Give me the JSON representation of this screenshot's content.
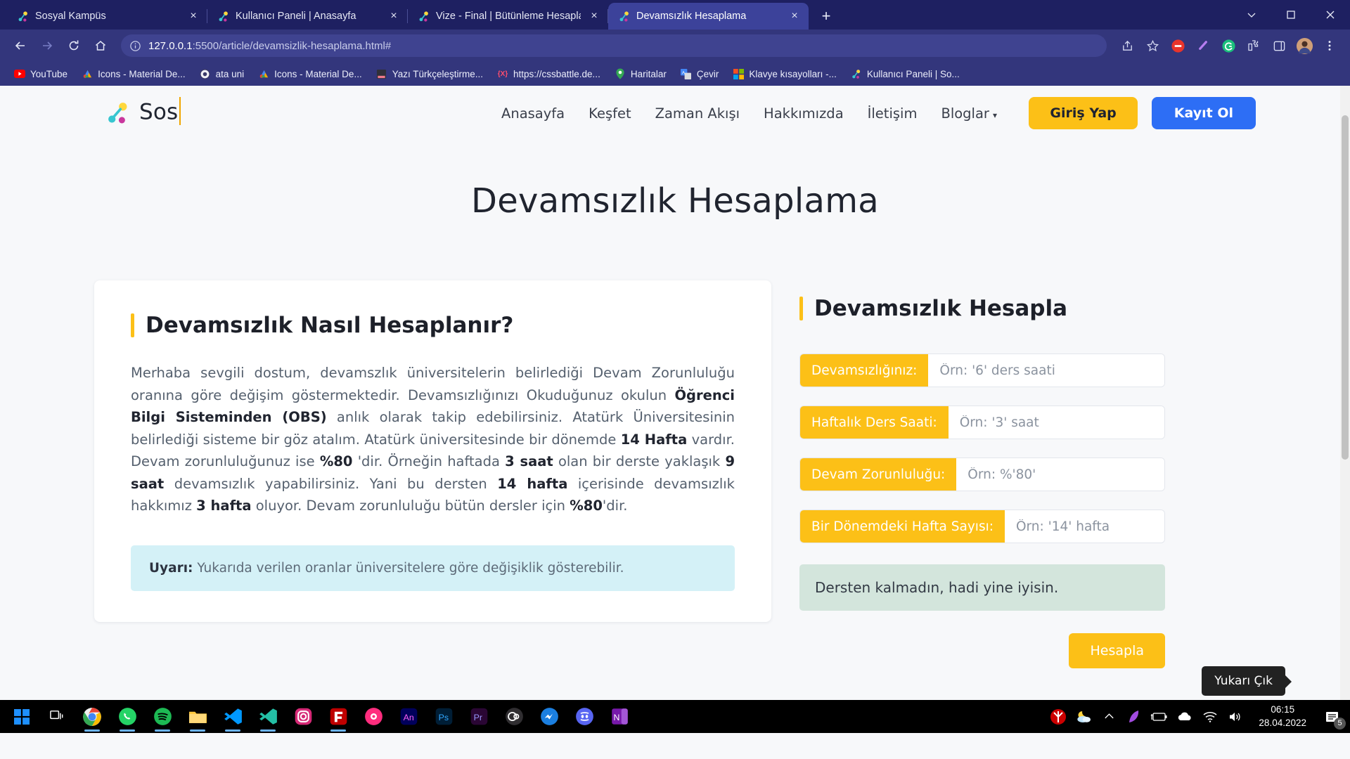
{
  "browser": {
    "tabs": [
      {
        "title": "Sosyal Kampüs",
        "icon": "sosyal-kampus-favicon",
        "active": false,
        "close_label": "×"
      },
      {
        "title": "Kullanıcı Paneli | Anasayfa",
        "icon": "sosyal-kampus-favicon",
        "active": false,
        "close_label": "×"
      },
      {
        "title": "Vize - Final | Bütünleme Hesaplama",
        "icon": "sosyal-kampus-favicon",
        "active": false,
        "close_label": "×"
      },
      {
        "title": "Devamsızlık Hesaplama",
        "icon": "sosyal-kampus-favicon",
        "active": true,
        "close_label": "×"
      }
    ],
    "new_tab_label": "+",
    "window_controls": {
      "minimize": "⌄",
      "restore": "▭",
      "close": "✕"
    },
    "toolbar": {
      "back": "back-arrow-icon",
      "forward": "forward-arrow-icon",
      "reload": "reload-icon",
      "home": "home-icon",
      "site_info": "info-icon",
      "url_host": "127.0.0.1",
      "url_rest": ":5500/article/devamsizlik-hesaplama.html#",
      "share": "share-icon",
      "bookmark": "star-icon",
      "extensions": "puzzle-icon",
      "sidepanel": "side-panel-icon",
      "menu": "kebab-menu-icon"
    },
    "bookmarks": [
      {
        "label": "YouTube",
        "icon": "youtube-icon"
      },
      {
        "label": "Icons - Material De...",
        "icon": "google-icon"
      },
      {
        "label": "ata uni",
        "icon": "ataturk-university-icon"
      },
      {
        "label": "Icons - Material De...",
        "icon": "google-icon"
      },
      {
        "label": "Yazı Türkçeleştirme...",
        "icon": "document-icon"
      },
      {
        "label": "https://cssbattle.de...",
        "icon": "cssbattle-icon"
      },
      {
        "label": "Haritalar",
        "icon": "google-maps-icon"
      },
      {
        "label": "Çevir",
        "icon": "google-translate-icon"
      },
      {
        "label": "Klavye kısayolları -...",
        "icon": "windows-icon"
      },
      {
        "label": "Kullanıcı Paneli | So...",
        "icon": "sosyal-kampus-favicon"
      }
    ]
  },
  "site": {
    "brand": {
      "name": "Sos",
      "logo": "sosyal-kampus-logo"
    },
    "nav": [
      {
        "label": "Anasayfa",
        "dropdown": false
      },
      {
        "label": "Keşfet",
        "dropdown": false
      },
      {
        "label": "Zaman Akışı",
        "dropdown": false
      },
      {
        "label": "Hakkımızda",
        "dropdown": false
      },
      {
        "label": "İletişim",
        "dropdown": false
      },
      {
        "label": "Bloglar",
        "dropdown": true,
        "chevron": "▾"
      }
    ],
    "auth": {
      "login": "Giriş Yap",
      "signup": "Kayıt Ol"
    },
    "page_title": "Devamsızlık Hesaplama"
  },
  "article": {
    "heading": "Devamsızlık Nasıl Hesaplanır?",
    "paragraph_parts": [
      {
        "t": "Merhaba sevgili dostum, devamszlık üniversitelerin belirlediği Devam Zorunluluğu oranına göre değişim göstermektedir. Devamsızlığınızı Okuduğunuz okulun ",
        "b": false
      },
      {
        "t": "Öğrenci Bilgi Sisteminden (OBS)",
        "b": true
      },
      {
        "t": " anlık olarak takip edebilirsiniz. Atatürk Üniversitesinin belirlediği sisteme bir göz atalım. Atatürk üniversitesinde bir dönemde ",
        "b": false
      },
      {
        "t": "14 Hafta",
        "b": true
      },
      {
        "t": " vardır. Devam zorunluluğunuz ise ",
        "b": false
      },
      {
        "t": "%80",
        "b": true
      },
      {
        "t": " 'dir. Örneğin haftada ",
        "b": false
      },
      {
        "t": "3 saat",
        "b": true
      },
      {
        "t": " olan bir derste yaklaşık ",
        "b": false
      },
      {
        "t": "9 saat",
        "b": true
      },
      {
        "t": " devamsızlık yapabilirsiniz. Yani bu dersten ",
        "b": false
      },
      {
        "t": "14 hafta",
        "b": true
      },
      {
        "t": " içerisinde devamsızlık hakkımız ",
        "b": false
      },
      {
        "t": "3 hafta",
        "b": true
      },
      {
        "t": " oluyor. Devam zorunluluğu bütün dersler için ",
        "b": false
      },
      {
        "t": "%80",
        "b": true
      },
      {
        "t": "'dir.",
        "b": false
      }
    ],
    "notice_label": "Uyarı:",
    "notice_text": " Yukarıda verilen oranlar üniversitelere göre değişiklik gösterebilir."
  },
  "calculator": {
    "heading": "Devamsızlık Hesapla",
    "fields": [
      {
        "label": "Devamsızlığınız:",
        "placeholder": "Örn: '6' ders saati",
        "value": ""
      },
      {
        "label": "Haftalık Ders Saati:",
        "placeholder": "Örn: '3' saat",
        "value": ""
      },
      {
        "label": "Devam Zorunluluğu:",
        "placeholder": "Örn: %'80'",
        "value": ""
      },
      {
        "label": "Bir Dönemdeki Hafta Sayısı:",
        "placeholder": "Örn: '14' hafta",
        "value": ""
      }
    ],
    "result": "Dersten kalmadın, hadi yine iyisin.",
    "calc_button": "Hesapla"
  },
  "scroll_top_tooltip": "Yukarı Çık",
  "taskbar": {
    "items": [
      {
        "name": "start-button",
        "icon": "windows-logo"
      },
      {
        "name": "task-view-button",
        "icon": "task-view-icon"
      },
      {
        "name": "chrome-app",
        "icon": "chrome-icon",
        "running": true
      },
      {
        "name": "whatsapp-app",
        "icon": "whatsapp-icon",
        "running": true
      },
      {
        "name": "spotify-app",
        "icon": "spotify-icon",
        "running": true
      },
      {
        "name": "file-explorer-app",
        "icon": "file-explorer-icon",
        "running": true
      },
      {
        "name": "vscode-app",
        "icon": "vscode-icon",
        "running": true
      },
      {
        "name": "vscode-insiders-app",
        "icon": "vscode-insiders-icon",
        "running": true
      },
      {
        "name": "instagram-app",
        "icon": "instagram-icon",
        "running": false
      },
      {
        "name": "filezilla-app",
        "icon": "filezilla-icon",
        "running": true
      },
      {
        "name": "figma-app",
        "icon": "figma-icon",
        "running": false
      },
      {
        "name": "adobe-animate-app",
        "icon": "animate-icon",
        "running": false
      },
      {
        "name": "adobe-photoshop-app",
        "icon": "photoshop-icon",
        "running": false
      },
      {
        "name": "adobe-premiere-app",
        "icon": "premiere-icon",
        "running": false
      },
      {
        "name": "obs-app",
        "icon": "obs-icon",
        "running": false
      },
      {
        "name": "messenger-app",
        "icon": "messenger-icon",
        "running": false
      },
      {
        "name": "discord-app",
        "icon": "discord-icon",
        "running": false
      },
      {
        "name": "onenote-app",
        "icon": "onenote-icon",
        "running": false
      }
    ],
    "tray": [
      {
        "name": "yandex-tray-icon",
        "icon": "yandex-icon"
      },
      {
        "name": "weather-tray-icon",
        "icon": "weather-night-cloud-icon"
      },
      {
        "name": "show-hidden-icons",
        "icon": "chevron-up-icon"
      },
      {
        "name": "app-tray-icon",
        "icon": "feather-icon"
      },
      {
        "name": "battery-tray-icon",
        "icon": "battery-charging-icon"
      },
      {
        "name": "onedrive-tray-icon",
        "icon": "cloud-icon"
      },
      {
        "name": "network-tray-icon",
        "icon": "wifi-icon"
      },
      {
        "name": "volume-tray-icon",
        "icon": "speaker-icon"
      }
    ],
    "clock_time": "06:15",
    "clock_date": "28.04.2022",
    "notification_count": "5"
  },
  "colors": {
    "brand_yellow": "#fcc017",
    "brand_blue": "#2d6ef5",
    "chrome_blue": "#33367c",
    "notice_bg": "#d4f1f7",
    "result_bg": "#d3e5dc"
  }
}
